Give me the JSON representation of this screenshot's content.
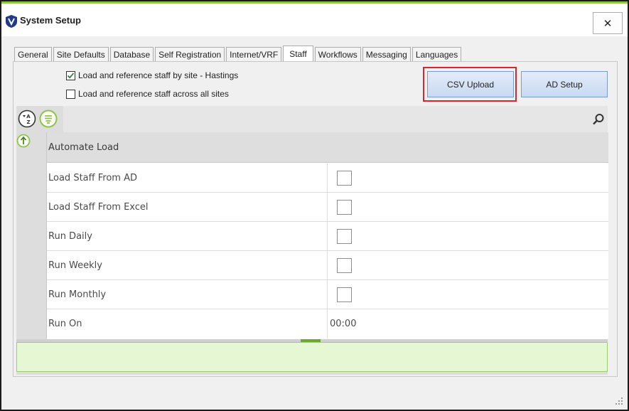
{
  "window": {
    "title": "System Setup",
    "close_label": "✕"
  },
  "tabs": [
    {
      "label": "General",
      "active": false
    },
    {
      "label": "Site Defaults",
      "active": false
    },
    {
      "label": "Database",
      "active": false
    },
    {
      "label": "Self Registration",
      "active": false
    },
    {
      "label": "Internet/VRF",
      "active": false
    },
    {
      "label": "Staff",
      "active": true
    },
    {
      "label": "Workflows",
      "active": false
    },
    {
      "label": "Messaging",
      "active": false
    },
    {
      "label": "Languages",
      "active": false
    }
  ],
  "options": {
    "by_site": {
      "label": "Load and reference staff by site - Hastings",
      "checked": true
    },
    "across_sites": {
      "label": "Load and reference staff across all sites",
      "checked": false
    }
  },
  "buttons": {
    "csv_upload": "CSV Upload",
    "ad_setup": "AD Setup"
  },
  "grid": {
    "group_header": "Automate Load",
    "rows": [
      {
        "label": "Load Staff From AD",
        "type": "checkbox",
        "checked": false
      },
      {
        "label": "Load Staff From Excel",
        "type": "checkbox",
        "checked": false
      },
      {
        "label": "Run Daily",
        "type": "checkbox",
        "checked": false
      },
      {
        "label": "Run Weekly",
        "type": "checkbox",
        "checked": false
      },
      {
        "label": "Run Monthly",
        "type": "checkbox",
        "checked": false
      },
      {
        "label": "Run On",
        "type": "text",
        "value": "00:00"
      }
    ]
  },
  "icons": {
    "app": "app-logo-icon",
    "sort": "sort-az-icon",
    "filter": "filter-icon",
    "search": "search-icon",
    "collapse": "collapse-up-icon"
  },
  "colors": {
    "accent_green": "#8dc63f",
    "highlight_red": "#d9262b",
    "button_blue": "#c9d9f2"
  }
}
